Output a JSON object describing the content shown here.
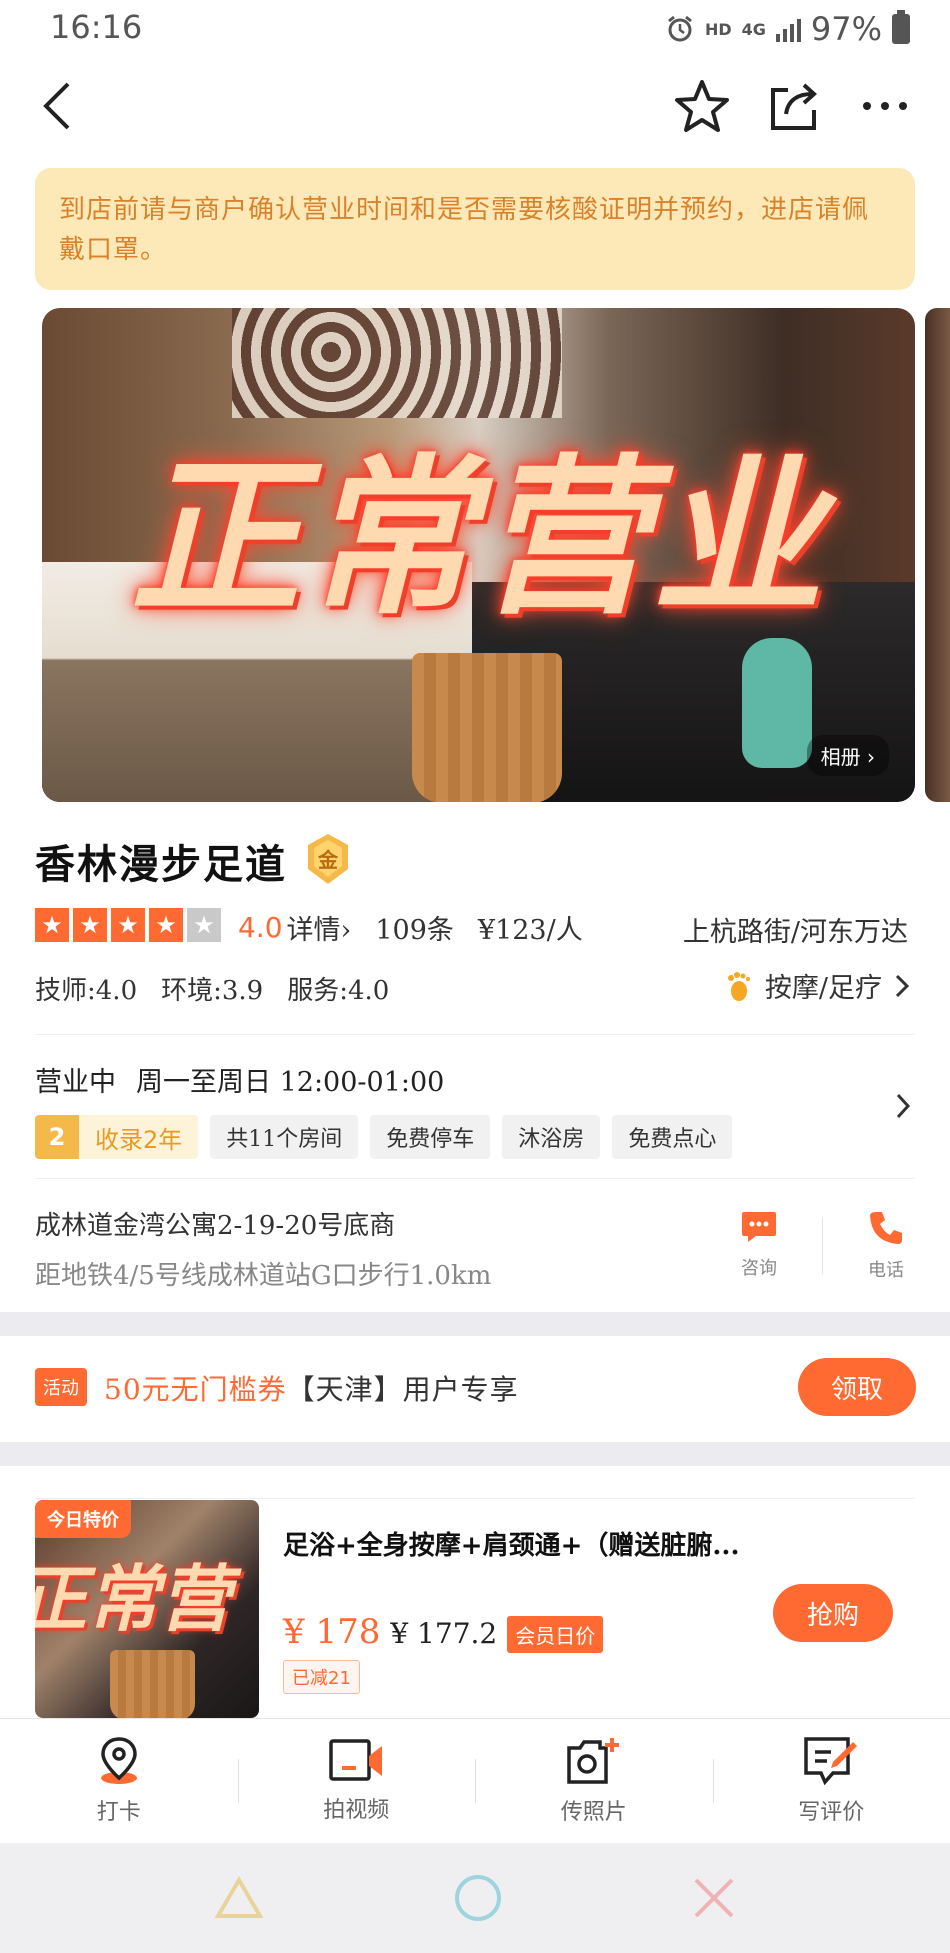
{
  "status_bar": {
    "time": "16:16",
    "hd": "HD",
    "network": "4G",
    "battery": "97%"
  },
  "notice": "到店前请与商户确认营业时间和是否需要核酸证明并预约，进店请佩戴口罩。",
  "banner": {
    "text": "正常营业",
    "album_label": "相册 ›"
  },
  "shop": {
    "name": "香林漫步足道",
    "badge": "金",
    "rating": 4.0,
    "rating_text": "4.0",
    "details_link": "详情›",
    "reviews": "109条",
    "price_per_person": "¥123/人",
    "area": "上杭路街/河东万达",
    "subscores": [
      "技师:4.0",
      "环境:3.9",
      "服务:4.0"
    ],
    "category": "按摩/足疗",
    "hours_status": "营业中",
    "hours": "周一至周日 12:00-01:00",
    "years_num": "2",
    "years_text": "收录2年",
    "tags": [
      "共11个房间",
      "免费停车",
      "沐浴房",
      "免费点心"
    ],
    "address": "成林道金湾公寓2-19-20号底商",
    "distance": "距地铁4/5号线成林道站G口步行1.0km",
    "actions": [
      {
        "label": "咨询",
        "icon": "chat-icon"
      },
      {
        "label": "电话",
        "icon": "phone-icon"
      }
    ]
  },
  "promo": {
    "tag": "活动",
    "highlight": "50元无门槛券",
    "text": "【天津】用户专享",
    "button": "领取"
  },
  "deal": {
    "ribbon": "今日特价",
    "image_text": "正常营",
    "title": "足浴+全身按摩+肩颈通+（赠送脏腑...",
    "price": "¥ 178",
    "member_price": "¥ 177.2",
    "member_tag": "会员日价",
    "discount": "已减21",
    "button": "抢购"
  },
  "tabbar": [
    {
      "label": "打卡",
      "icon": "location-pin-icon"
    },
    {
      "label": "拍视频",
      "icon": "video-camera-icon"
    },
    {
      "label": "传照片",
      "icon": "add-photo-icon"
    },
    {
      "label": "写评价",
      "icon": "write-review-icon"
    }
  ],
  "colors": {
    "accent": "#ff6a33",
    "notice_bg": "#fde9b8",
    "notice_text": "#d9822b",
    "gold": "#f5b94a"
  }
}
